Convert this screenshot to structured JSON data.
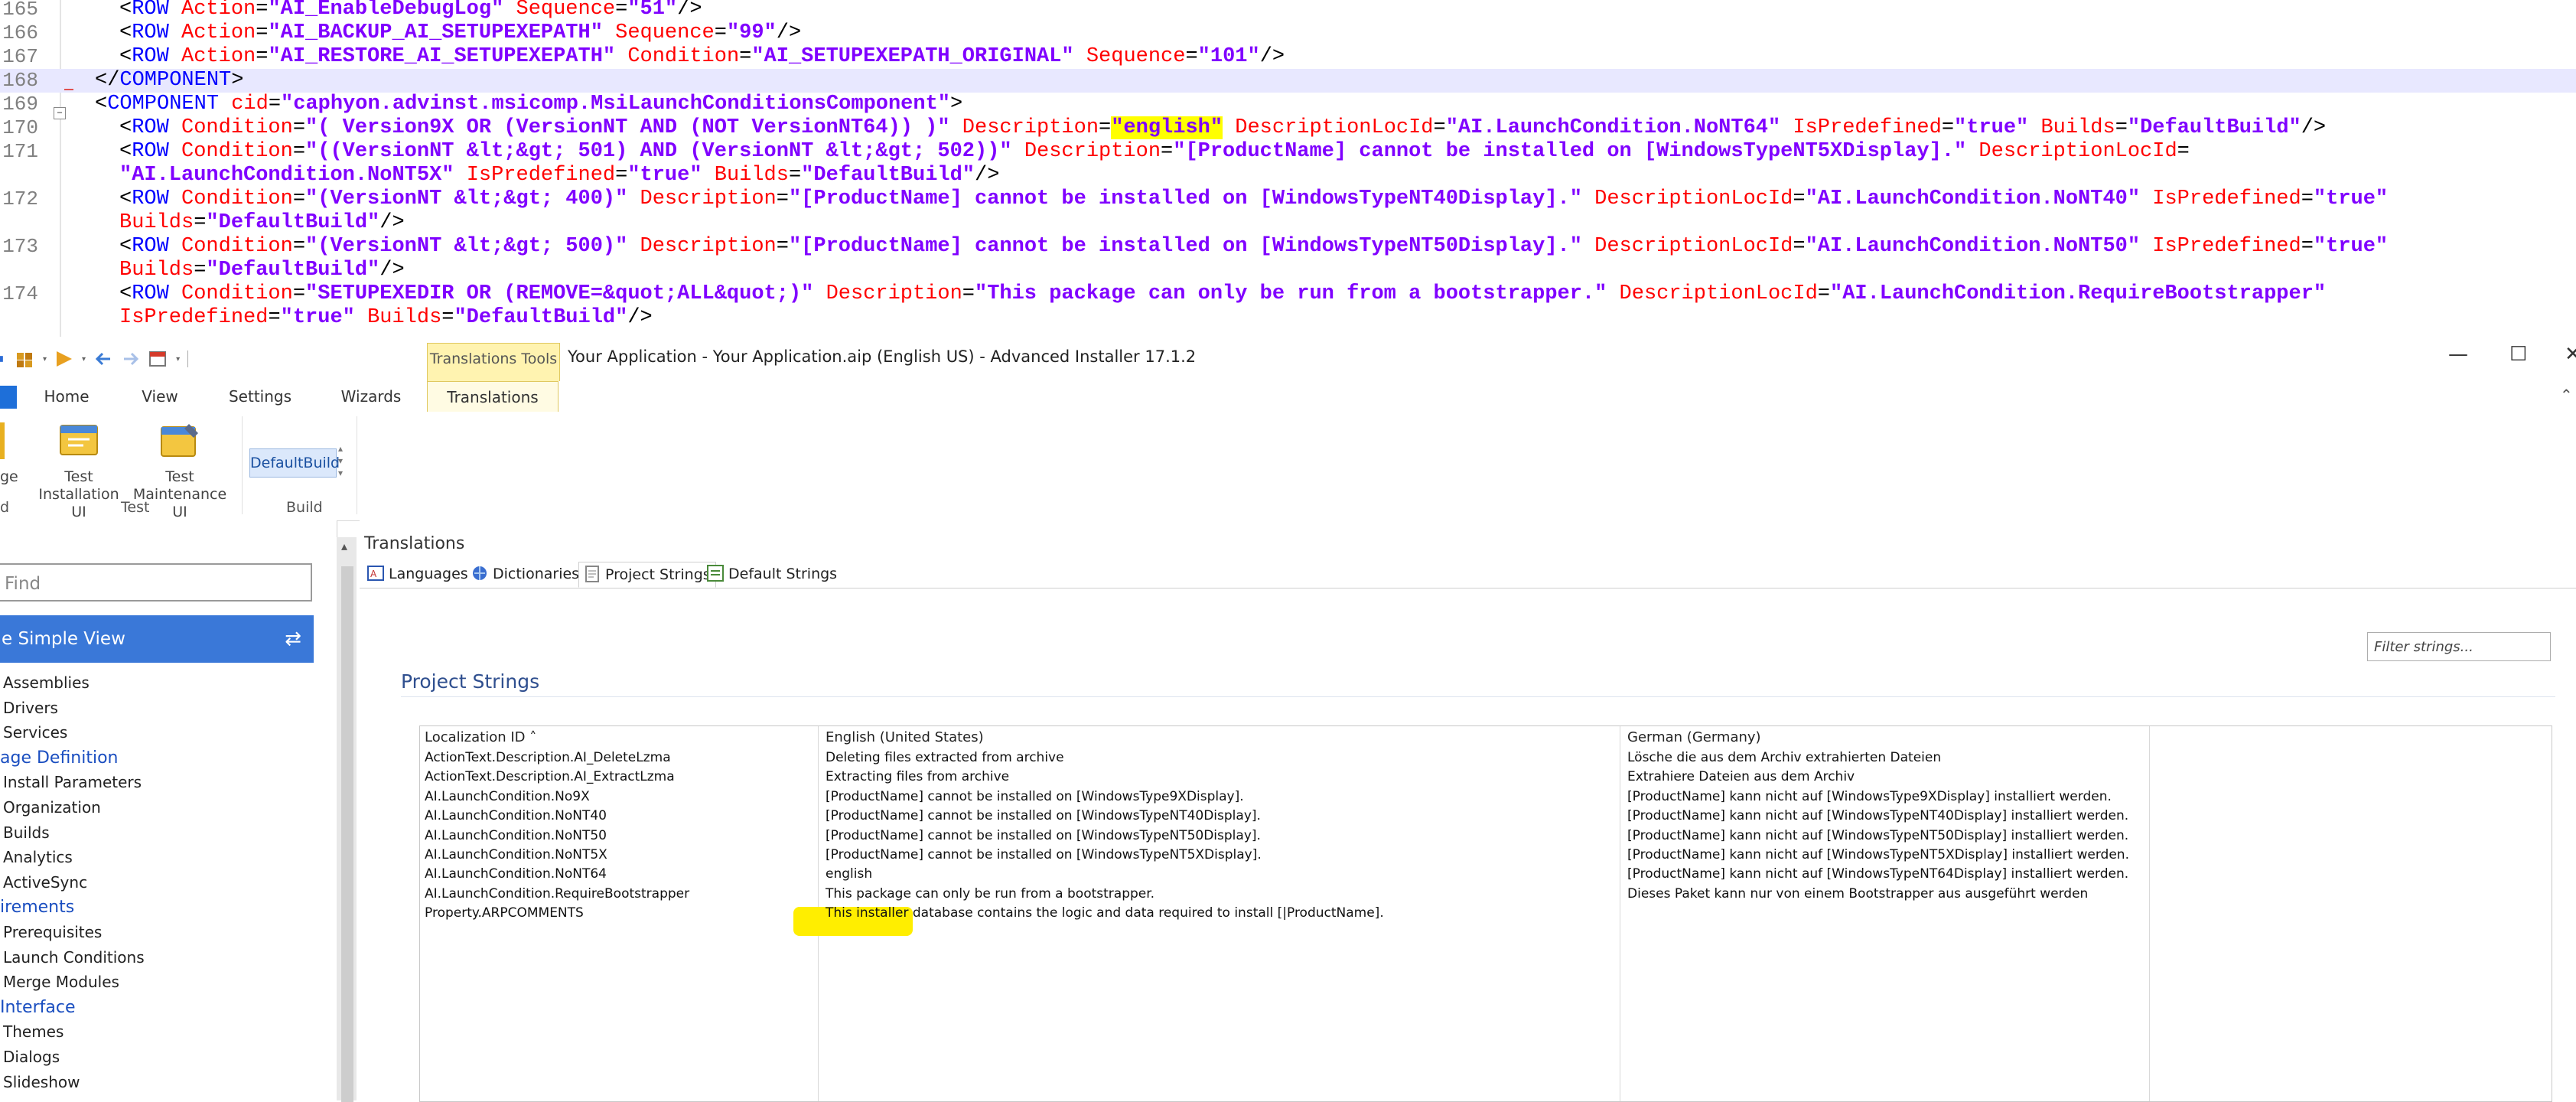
{
  "editor": {
    "lines": [
      {
        "no": "165",
        "text": [
          [
            "t",
            "<"
          ],
          [
            "tag",
            "ROW "
          ],
          [
            "attr",
            "Action"
          ],
          [
            "t",
            "="
          ],
          [
            "val",
            "\"AI_EnableDebugLog\""
          ],
          [
            "t",
            " "
          ],
          [
            "attr",
            "Sequence"
          ],
          [
            "t",
            "="
          ],
          [
            "val",
            "\"51\""
          ],
          [
            "t",
            "/>"
          ]
        ]
      },
      {
        "no": "166",
        "text": [
          [
            "t",
            "<"
          ],
          [
            "tag",
            "ROW "
          ],
          [
            "attr",
            "Action"
          ],
          [
            "t",
            "="
          ],
          [
            "val",
            "\"AI_BACKUP_AI_SETUPEXEPATH\""
          ],
          [
            "t",
            " "
          ],
          [
            "attr",
            "Sequence"
          ],
          [
            "t",
            "="
          ],
          [
            "val",
            "\"99\""
          ],
          [
            "t",
            "/>"
          ]
        ]
      },
      {
        "no": "167",
        "text": [
          [
            "t",
            "<"
          ],
          [
            "tag",
            "ROW "
          ],
          [
            "attr",
            "Action"
          ],
          [
            "t",
            "="
          ],
          [
            "val",
            "\"AI_RESTORE_AI_SETUPEXEPATH\""
          ],
          [
            "t",
            " "
          ],
          [
            "attr",
            "Condition"
          ],
          [
            "t",
            "="
          ],
          [
            "val",
            "\"AI_SETUPEXEPATH_ORIGINAL\""
          ],
          [
            "t",
            " "
          ],
          [
            "attr",
            "Sequence"
          ],
          [
            "t",
            "="
          ],
          [
            "val",
            "\"101\""
          ],
          [
            "t",
            "/>"
          ]
        ]
      },
      {
        "no": "168",
        "text": [
          [
            "t",
            "</"
          ],
          [
            "tag",
            "COMPONENT"
          ],
          [
            "t",
            ">"
          ]
        ]
      },
      {
        "no": "169",
        "text": [
          [
            "t",
            "<"
          ],
          [
            "tag",
            "COMPONENT "
          ],
          [
            "attr",
            "cid"
          ],
          [
            "t",
            "="
          ],
          [
            "val",
            "\"caphyon.advinst.msicomp.MsiLaunchConditionsComponent\""
          ],
          [
            "t",
            ">"
          ]
        ]
      },
      {
        "no": "170",
        "text": [
          [
            "t",
            "<"
          ],
          [
            "tag",
            "ROW "
          ],
          [
            "attr",
            "Condition"
          ],
          [
            "t",
            "="
          ],
          [
            "val",
            "\"( Version9X OR (VersionNT AND (NOT VersionNT64)) )\""
          ],
          [
            "t",
            " "
          ],
          [
            "attr",
            "Description"
          ],
          [
            "t",
            "="
          ],
          [
            "mark",
            "\"english\""
          ],
          [
            "t",
            " "
          ],
          [
            "attr",
            "DescriptionLocId"
          ],
          [
            "t",
            "="
          ],
          [
            "val",
            "\"AI.LaunchCondition.NoNT64\""
          ],
          [
            "t",
            " "
          ],
          [
            "attr",
            "IsPredefined"
          ],
          [
            "t",
            "="
          ],
          [
            "val",
            "\"true\""
          ],
          [
            "t",
            " "
          ],
          [
            "attr",
            "Builds"
          ],
          [
            "t",
            "="
          ],
          [
            "val",
            "\"DefaultBuild\""
          ],
          [
            "t",
            "/>"
          ]
        ]
      },
      {
        "no": "171",
        "text": [
          [
            "t",
            "<"
          ],
          [
            "tag",
            "ROW "
          ],
          [
            "attr",
            "Condition"
          ],
          [
            "t",
            "="
          ],
          [
            "val",
            "\"((VersionNT &lt;&gt; 501) AND (VersionNT &lt;&gt; 502))\""
          ],
          [
            "t",
            " "
          ],
          [
            "attr",
            "Description"
          ],
          [
            "t",
            "="
          ],
          [
            "val",
            "\"[ProductName] cannot be installed on [WindowsTypeNT5XDisplay].\""
          ],
          [
            "t",
            " "
          ],
          [
            "attr",
            "DescriptionLocId"
          ],
          [
            "t",
            "="
          ]
        ]
      },
      {
        "no": "",
        "text": [
          [
            "val",
            "\"AI.LaunchCondition.NoNT5X\""
          ],
          [
            "t",
            " "
          ],
          [
            "attr",
            "IsPredefined"
          ],
          [
            "t",
            "="
          ],
          [
            "val",
            "\"true\""
          ],
          [
            "t",
            " "
          ],
          [
            "attr",
            "Builds"
          ],
          [
            "t",
            "="
          ],
          [
            "val",
            "\"DefaultBuild\""
          ],
          [
            "t",
            "/>"
          ]
        ]
      },
      {
        "no": "172",
        "text": [
          [
            "t",
            "<"
          ],
          [
            "tag",
            "ROW "
          ],
          [
            "attr",
            "Condition"
          ],
          [
            "t",
            "="
          ],
          [
            "val",
            "\"(VersionNT &lt;&gt; 400)\""
          ],
          [
            "t",
            " "
          ],
          [
            "attr",
            "Description"
          ],
          [
            "t",
            "="
          ],
          [
            "val",
            "\"[ProductName] cannot be installed on [WindowsTypeNT40Display].\""
          ],
          [
            "t",
            " "
          ],
          [
            "attr",
            "DescriptionLocId"
          ],
          [
            "t",
            "="
          ],
          [
            "val",
            "\"AI.LaunchCondition.NoNT40\""
          ],
          [
            "t",
            " "
          ],
          [
            "attr",
            "IsPredefined"
          ],
          [
            "t",
            "="
          ],
          [
            "val",
            "\"true\""
          ]
        ]
      },
      {
        "no": "",
        "text": [
          [
            "attr",
            "Builds"
          ],
          [
            "t",
            "="
          ],
          [
            "val",
            "\"DefaultBuild\""
          ],
          [
            "t",
            "/>"
          ]
        ]
      },
      {
        "no": "173",
        "text": [
          [
            "t",
            "<"
          ],
          [
            "tag",
            "ROW "
          ],
          [
            "attr",
            "Condition"
          ],
          [
            "t",
            "="
          ],
          [
            "val",
            "\"(VersionNT &lt;&gt; 500)\""
          ],
          [
            "t",
            " "
          ],
          [
            "attr",
            "Description"
          ],
          [
            "t",
            "="
          ],
          [
            "val",
            "\"[ProductName] cannot be installed on [WindowsTypeNT50Display].\""
          ],
          [
            "t",
            " "
          ],
          [
            "attr",
            "DescriptionLocId"
          ],
          [
            "t",
            "="
          ],
          [
            "val",
            "\"AI.LaunchCondition.NoNT50\""
          ],
          [
            "t",
            " "
          ],
          [
            "attr",
            "IsPredefined"
          ],
          [
            "t",
            "="
          ],
          [
            "val",
            "\"true\""
          ]
        ]
      },
      {
        "no": "",
        "text": [
          [
            "attr",
            "Builds"
          ],
          [
            "t",
            "="
          ],
          [
            "val",
            "\"DefaultBuild\""
          ],
          [
            "t",
            "/>"
          ]
        ]
      },
      {
        "no": "174",
        "text": [
          [
            "t",
            "<"
          ],
          [
            "tag",
            "ROW "
          ],
          [
            "attr",
            "Condition"
          ],
          [
            "t",
            "="
          ],
          [
            "val",
            "\"SETUPEXEDIR OR (REMOVE=&quot;ALL&quot;)\""
          ],
          [
            "t",
            " "
          ],
          [
            "attr",
            "Description"
          ],
          [
            "t",
            "="
          ],
          [
            "val",
            "\"This package can only be run from a bootstrapper.\""
          ],
          [
            "t",
            " "
          ],
          [
            "attr",
            "DescriptionLocId"
          ],
          [
            "t",
            "="
          ],
          [
            "val",
            "\"AI.LaunchCondition.RequireBootstrapper\""
          ]
        ]
      },
      {
        "no": "",
        "text": [
          [
            "attr",
            "IsPredefined"
          ],
          [
            "t",
            "="
          ],
          [
            "val",
            "\"true\""
          ],
          [
            "t",
            " "
          ],
          [
            "attr",
            "Builds"
          ],
          [
            "t",
            "="
          ],
          [
            "val",
            "\"DefaultBuild\""
          ],
          [
            "t",
            "/>"
          ]
        ]
      }
    ]
  },
  "window": {
    "context_tab": "Translations Tools",
    "title": "Your Application - Your Application.aip (English US) - Advanced Installer 17.1.2",
    "minimize": "—",
    "maximize": "☐",
    "close": "✕"
  },
  "tabs": [
    "Home",
    "View",
    "Settings",
    "Wizards",
    "Translations"
  ],
  "ribbon": {
    "cut_label_1": "ge",
    "cut_label_2": "d",
    "test_install_1": "Test",
    "test_install_2": "Installation UI",
    "test_maint_1": "Test",
    "test_maint_2": "Maintenance UI",
    "group_test": "Test",
    "group_build": "Build",
    "build_combo": "DefaultBuild"
  },
  "left": {
    "find_placeholder": "Find",
    "simple_view": "e Simple View",
    "items": [
      {
        "label": "Assemblies",
        "head": false
      },
      {
        "label": "Drivers",
        "head": false
      },
      {
        "label": "Services",
        "head": false
      },
      {
        "label": "age Definition",
        "head": true
      },
      {
        "label": "Install Parameters",
        "head": false
      },
      {
        "label": "Organization",
        "head": false
      },
      {
        "label": "Builds",
        "head": false
      },
      {
        "label": "Analytics",
        "head": false
      },
      {
        "label": "ActiveSync",
        "head": false
      },
      {
        "label": "irements",
        "head": true
      },
      {
        "label": "Prerequisites",
        "head": false
      },
      {
        "label": "Launch Conditions",
        "head": false
      },
      {
        "label": "Merge Modules",
        "head": false
      },
      {
        "label": "Interface",
        "head": true
      },
      {
        "label": "Themes",
        "head": false
      },
      {
        "label": "Dialogs",
        "head": false
      },
      {
        "label": "Slideshow",
        "head": false
      }
    ]
  },
  "main": {
    "title": "Translations",
    "subtabs": [
      "Languages",
      "Dictionaries",
      "Project Strings",
      "Default Strings"
    ],
    "filter_placeholder": "Filter strings...",
    "section_title": "Project Strings",
    "columns": [
      "Localization ID  ˄",
      "English (United States)",
      "German (Germany)"
    ],
    "rows": [
      [
        "ActionText.Description.AI_DeleteLzma",
        "Deleting files extracted from archive",
        "Lösche die aus dem Archiv extrahierten Dateien"
      ],
      [
        "ActionText.Description.AI_ExtractLzma",
        "Extracting files from archive",
        "Extrahiere Dateien aus dem Archiv"
      ],
      [
        "AI.LaunchCondition.No9X",
        "[ProductName] cannot be installed on [WindowsType9XDisplay].",
        "[ProductName] kann nicht auf [WindowsType9XDisplay] installiert werden."
      ],
      [
        "AI.LaunchCondition.NoNT40",
        "[ProductName] cannot be installed on [WindowsTypeNT40Display].",
        "[ProductName] kann nicht auf [WindowsTypeNT40Display] installiert werden."
      ],
      [
        "AI.LaunchCondition.NoNT50",
        "[ProductName] cannot be installed on [WindowsTypeNT50Display].",
        "[ProductName] kann nicht auf [WindowsTypeNT50Display] installiert werden."
      ],
      [
        "AI.LaunchCondition.NoNT5X",
        "[ProductName] cannot be installed on [WindowsTypeNT5XDisplay].",
        "[ProductName] kann nicht auf [WindowsTypeNT5XDisplay] installiert werden."
      ],
      [
        "AI.LaunchCondition.NoNT64",
        "english",
        "[ProductName] kann nicht auf [WindowsTypeNT64Display] installiert werden."
      ],
      [
        "AI.LaunchCondition.RequireBootstrapper",
        "This package can only be run from a bootstrapper.",
        "Dieses Paket kann nur von einem Bootstrapper aus ausgeführt werden"
      ],
      [
        "Property.ARPCOMMENTS",
        "This installer database contains the logic and data required to install [|ProductName].",
        ""
      ]
    ]
  },
  "colors": {
    "accent": "#3a78d8",
    "highlight": "#ffee00",
    "tag": "#0000ff",
    "attr": "#ff0000",
    "value": "#8000ff"
  }
}
